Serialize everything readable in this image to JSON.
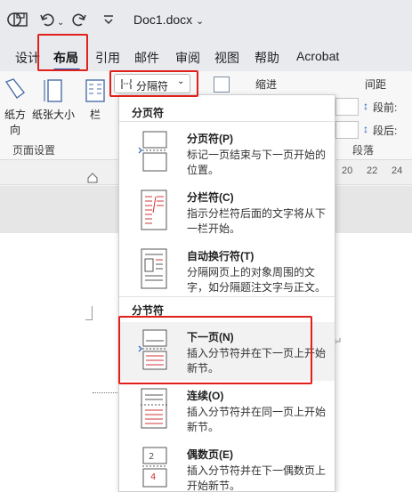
{
  "titlebar": {
    "doc_title": "Doc1.docx",
    "icons": [
      "word-icon",
      "save-icon",
      "undo-icon",
      "redo-icon",
      "customize-quick-access-icon"
    ]
  },
  "tabs": [
    {
      "label": "设计"
    },
    {
      "label": "布局"
    },
    {
      "label": "引用"
    },
    {
      "label": "邮件"
    },
    {
      "label": "审阅"
    },
    {
      "label": "视图"
    },
    {
      "label": "帮助"
    },
    {
      "label": "Acrobat"
    }
  ],
  "ribbon": {
    "orientation_label": "纸方向",
    "size_label": "纸张大小",
    "columns_label": "栏",
    "breaks_label": "分隔符",
    "group_page_setup": "页面设置",
    "indent_label": "缩进",
    "spacing_label": "间距",
    "before_label": "段前:",
    "after_label": "段后:",
    "group_paragraph": "段落"
  },
  "ruler": {
    "marks": [
      "20",
      "22",
      "24"
    ]
  },
  "dropdown": {
    "page_breaks_header": "分页符",
    "section_breaks_header": "分节符",
    "items": [
      {
        "title": "分页符(P)",
        "desc": "标记一页结束与下一页开始的位置。"
      },
      {
        "title": "分栏符(C)",
        "desc": "指示分栏符后面的文字将从下一栏开始。"
      },
      {
        "title": "自动换行符(T)",
        "desc": "分隔网页上的对象周围的文字，如分隔题注文字与正文。"
      },
      {
        "title": "下一页(N)",
        "desc": "插入分节符并在下一页上开始新节。"
      },
      {
        "title": "连续(O)",
        "desc": "插入分节符并在同一页上开始新节。"
      },
      {
        "title": "偶数页(E)",
        "desc": "插入分节符并在下一偶数页上开始新节。"
      }
    ]
  },
  "colors": {
    "highlight_box": "#e0201b",
    "accent": "#185abd",
    "icon_red": "#d13438"
  }
}
